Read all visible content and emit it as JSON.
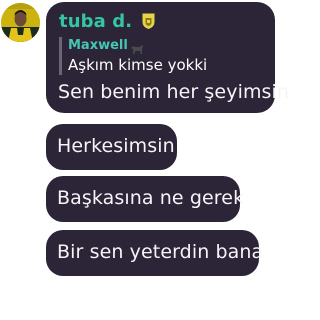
{
  "author": {
    "name": "tuba d.",
    "badge_icon": "shield-badge-icon",
    "accent_color": "#35c5a6"
  },
  "reply": {
    "name": "Maxwell",
    "name_icon": "dog-icon",
    "text": "Aşkım kimse yokki"
  },
  "messages": [
    "Sen benim her şeyimsin",
    "Herkesimsin",
    "Başkasına ne gerek",
    "Bir sen yeterdin bana"
  ],
  "colors": {
    "bubble": "#2b2537",
    "text": "#f6f4f8",
    "reply_bar": "#6a6577",
    "badge": "#e7d34a"
  }
}
